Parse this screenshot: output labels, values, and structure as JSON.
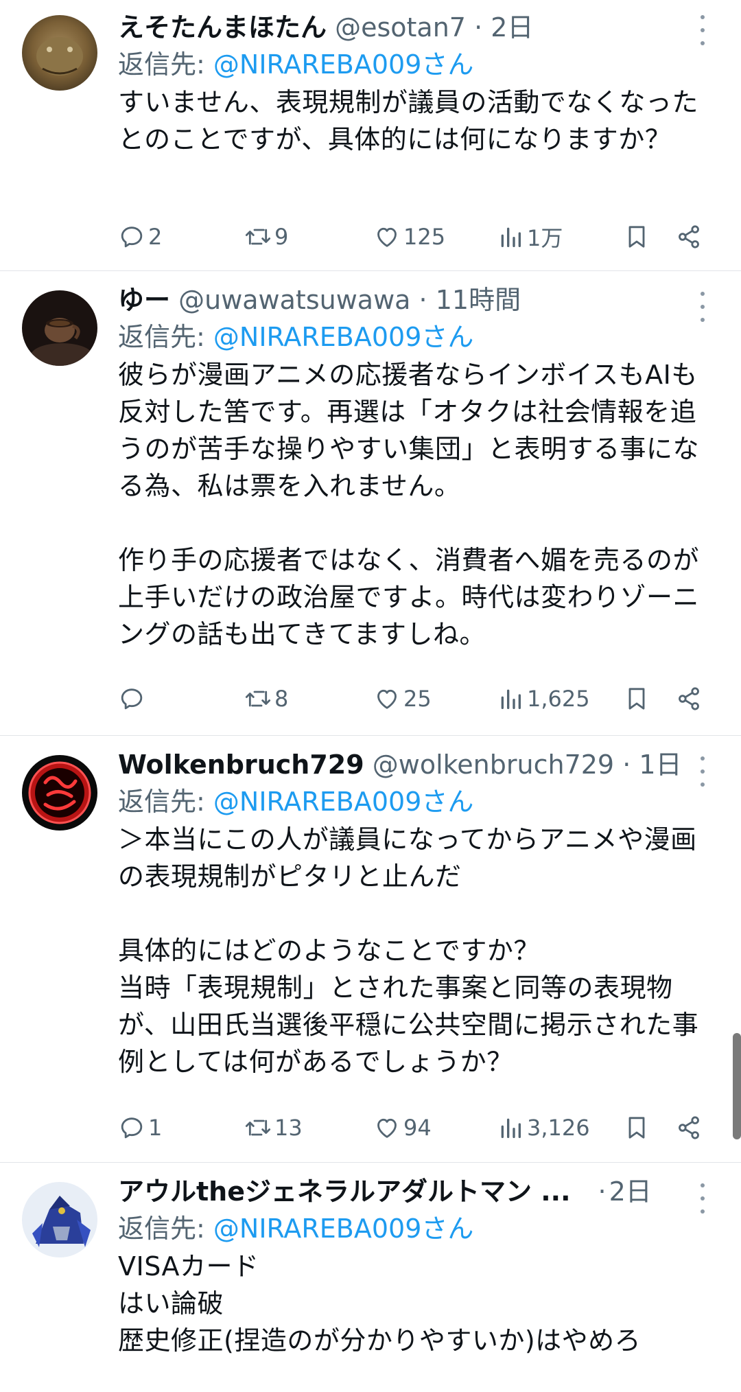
{
  "tweets": [
    {
      "name": "えそたんまほたん",
      "handle": "@esotan7",
      "separator": "·",
      "time": "2日",
      "reply_prefix": "返信先: ",
      "reply_mention": "@NIRAREBA009さん",
      "text": "すいません、表現規制が議員の活動でなくなったとのことですが、具体的には何になりますか？",
      "replies": "2",
      "retweets": "9",
      "likes": "125",
      "views": "1万"
    },
    {
      "name": "ゆー",
      "handle": "@uwawatsuwawa",
      "separator": "·",
      "time": "11時間",
      "reply_prefix": "返信先: ",
      "reply_mention": "@NIRAREBA009さん",
      "text": "彼らが漫画アニメの応援者ならインボイスもAIも反対した筈です。再選は「オタクは社会情報を追うのが苦手な操りやすい集団」と表明する事になる為、私は票を入れません。\n\n作り手の応援者ではなく、消費者へ媚を売るのが上手いだけの政治屋ですよ。時代は変わりゾーニングの話も出てきてますしね。",
      "replies": "",
      "retweets": "8",
      "likes": "25",
      "views": "1,625"
    },
    {
      "name": "Wolkenbruch729",
      "handle": "@wolkenbruch729",
      "separator": "·",
      "time": "1日",
      "reply_prefix": "返信先: ",
      "reply_mention": "@NIRAREBA009さん",
      "text": "＞本当にこの人が議員になってからアニメや漫画の表現規制がピタリと止んだ\n\n具体的にはどのようなことですか？\n当時「表現規制」とされた事案と同等の表現物が、山田氏当選後平穏に公共空間に掲示された事例としては何があるでしょうか？",
      "replies": "1",
      "retweets": "13",
      "likes": "94",
      "views": "3,126"
    },
    {
      "name": "アウルtheジェネラルアダルトマン ...",
      "handle": "",
      "separator": "·",
      "time": "2日",
      "reply_prefix": "返信先: ",
      "reply_mention": "@NIRAREBA009さん",
      "text": "VISAカード\nはい論破\n歴史修正(捏造のが分かりやすいか)はやめろ"
    }
  ],
  "icons": {
    "reply": "reply-icon",
    "retweet": "retweet-icon",
    "like": "heart-icon",
    "views": "views-icon",
    "bookmark": "bookmark-icon",
    "share": "share-icon",
    "more": "more-icon"
  },
  "colors": {
    "mention": "#1d9bf0",
    "secondary_text": "#536471",
    "divider": "#e1e4e8"
  }
}
